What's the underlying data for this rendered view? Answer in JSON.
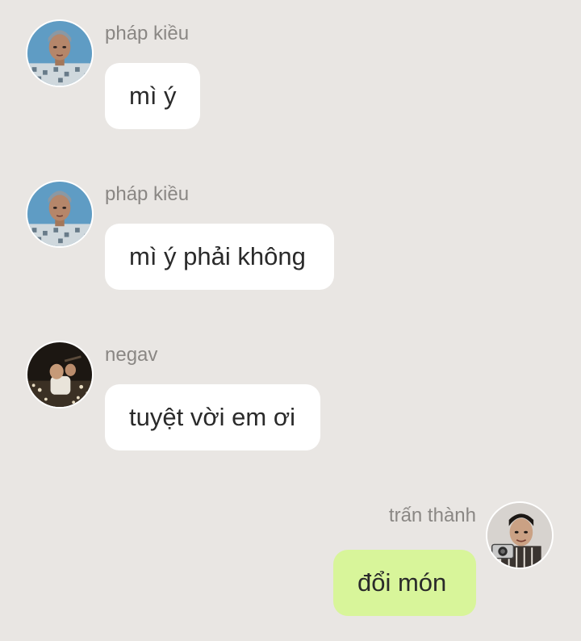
{
  "colors": {
    "background": "#e9e6e3",
    "incoming_bubble": "#ffffff",
    "outgoing_bubble": "#d8f59a",
    "sender_text": "#8a8784",
    "message_text": "#2a2a2a"
  },
  "messages": [
    {
      "sender": "pháp kiều",
      "text": "mì ý",
      "direction": "incoming",
      "avatar": "avatar-phap-kieu"
    },
    {
      "sender": "pháp kiều",
      "text": "mì ý phải không",
      "direction": "incoming",
      "avatar": "avatar-phap-kieu"
    },
    {
      "sender": "negav",
      "text": "tuyệt vời em ơi",
      "direction": "incoming",
      "avatar": "avatar-negav"
    },
    {
      "sender": "trấn thành",
      "text": "đổi món",
      "direction": "outgoing",
      "avatar": "avatar-tran-thanh"
    }
  ]
}
